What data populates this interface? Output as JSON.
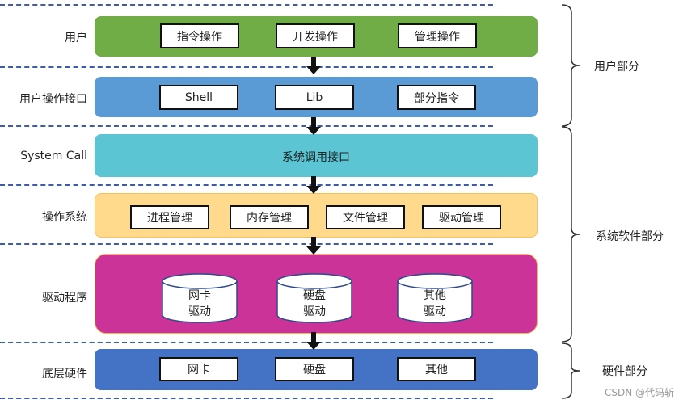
{
  "layers": [
    {
      "label": "用户",
      "color": "#70ad47",
      "items": [
        "指令操作",
        "开发操作",
        "管理操作"
      ]
    },
    {
      "label": "用户操作接口",
      "color": "#5b9bd5",
      "items": [
        "Shell",
        "Lib",
        "部分指令"
      ]
    },
    {
      "label": "System Call",
      "color": "#5bc5d4",
      "center_text": "系统调用接口"
    },
    {
      "label": "操作系统",
      "color": "#ffd98c",
      "items": [
        "进程管理",
        "内存管理",
        "文件管理",
        "驱动管理"
      ]
    },
    {
      "label": "驱动程序",
      "color": "#cc3399",
      "drivers": [
        [
          "网卡",
          "驱动"
        ],
        [
          "硬盘",
          "驱动"
        ],
        [
          "其他",
          "驱动"
        ]
      ]
    },
    {
      "label": "底层硬件",
      "color": "#4472c4",
      "items": [
        "网卡",
        "硬盘",
        "其他"
      ]
    }
  ],
  "groups": [
    {
      "label": "用户部分"
    },
    {
      "label": "系统软件部分"
    },
    {
      "label": "硬件部分"
    }
  ],
  "watermark": "CSDN @代码斩"
}
